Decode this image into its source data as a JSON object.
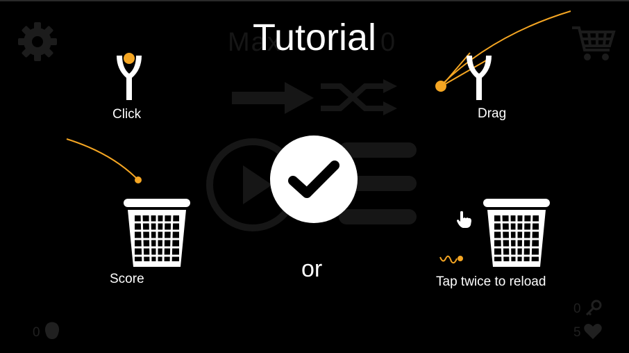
{
  "screen": {
    "title": "Tutorial",
    "background_title": "Max",
    "background_score": "0"
  },
  "instructions": {
    "click_label": "Click",
    "drag_label": "Drag",
    "score_label": "Score",
    "or_label": "or",
    "reload_label": "Tap twice to reload"
  },
  "hud": {
    "keys_count": "0",
    "lives_count": "5",
    "coins_count": "0"
  },
  "icons": {
    "settings": "gear-icon",
    "shop": "cart-icon",
    "confirm": "checkmark-icon",
    "key": "key-icon",
    "heart": "heart-icon",
    "coin": "coin-icon",
    "slingshot": "slingshot-icon",
    "bin": "trash-bin-icon",
    "hand": "hand-pointer-icon"
  },
  "colors": {
    "accent": "#f5a623",
    "foreground": "#ffffff",
    "background": "#000000",
    "dimmed": "#1e1e1e"
  }
}
